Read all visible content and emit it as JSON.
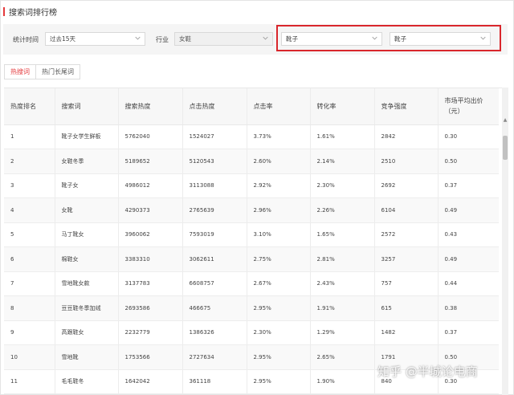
{
  "page_title": "搜索词排行榜",
  "filters": {
    "period_label": "统计时间",
    "period_value": "过去15天",
    "industry_label": "行业",
    "industry_value": "女鞋",
    "category1_value": "靴子",
    "category2_value": "靴子"
  },
  "tabs": [
    {
      "label": "热搜词",
      "active": true
    },
    {
      "label": "热门长尾词",
      "active": false
    }
  ],
  "table": {
    "headers": [
      "热度排名",
      "搜索词",
      "搜索热度",
      "点击热度",
      "点击率",
      "转化率",
      "竞争强度",
      "市场平均出价（元）"
    ],
    "rows": [
      [
        "1",
        "靴子女学生鲜板",
        "5762040",
        "1524027",
        "3.73%",
        "1.61%",
        "2842",
        "0.30"
      ],
      [
        "2",
        "女鞋冬季",
        "5189652",
        "5120543",
        "2.60%",
        "2.14%",
        "2510",
        "0.50"
      ],
      [
        "3",
        "靴子女",
        "4986012",
        "3113088",
        "2.92%",
        "2.30%",
        "2692",
        "0.37"
      ],
      [
        "4",
        "女靴",
        "4290373",
        "2765639",
        "2.96%",
        "2.26%",
        "6104",
        "0.49"
      ],
      [
        "5",
        "马丁靴女",
        "3960062",
        "7593019",
        "3.10%",
        "1.65%",
        "2572",
        "0.43"
      ],
      [
        "6",
        "棉鞋女",
        "3383310",
        "3062611",
        "2.75%",
        "2.81%",
        "3257",
        "0.49"
      ],
      [
        "7",
        "雪地靴女款",
        "3137783",
        "6608757",
        "2.67%",
        "2.43%",
        "757",
        "0.44"
      ],
      [
        "8",
        "豆豆鞋冬季加绒",
        "2693586",
        "466675",
        "2.95%",
        "1.91%",
        "615",
        "0.38"
      ],
      [
        "9",
        "高跟鞋女",
        "2232779",
        "1386326",
        "2.30%",
        "1.29%",
        "1482",
        "0.37"
      ],
      [
        "10",
        "雪地靴",
        "1753566",
        "2727634",
        "2.95%",
        "2.65%",
        "1791",
        "0.50"
      ],
      [
        "11",
        "毛毛鞋冬",
        "1642042",
        "361118",
        "2.95%",
        "1.90%",
        "840",
        "0.30"
      ]
    ]
  },
  "watermark": "知乎 @半城论电商",
  "colors": {
    "accent": "#e4393c",
    "highlight_box": "#d9262c"
  }
}
